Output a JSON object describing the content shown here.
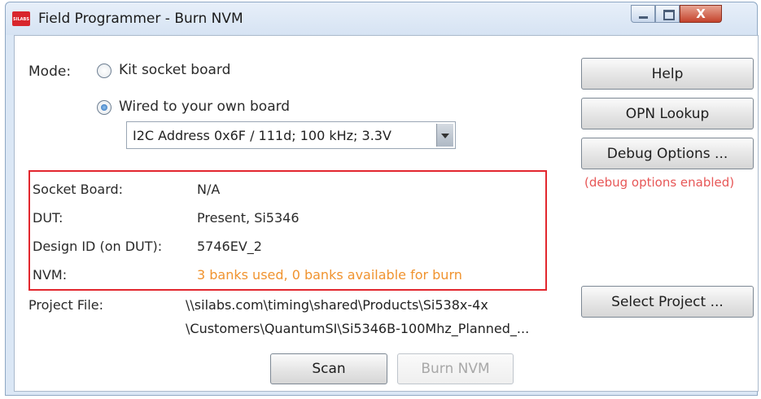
{
  "window": {
    "title": "Field Programmer - Burn NVM",
    "icon_text": "SILABS",
    "close_glyph": "X"
  },
  "mode": {
    "label": "Mode:",
    "options": [
      {
        "label": "Kit socket board",
        "selected": false
      },
      {
        "label": "Wired to your own board",
        "selected": true
      }
    ],
    "interface_select": {
      "value": "I2C Address 0x6F / 111d; 100 kHz; 3.3V"
    }
  },
  "status": {
    "rows": [
      {
        "label": "Socket Board:",
        "value": "N/A"
      },
      {
        "label": "DUT:",
        "value": "Present, Si5346"
      },
      {
        "label": "Design ID (on DUT):",
        "value": "5746EV_2"
      },
      {
        "label": "NVM:",
        "value": "3 banks used, 0 banks available for burn",
        "color": "#f0932f"
      }
    ],
    "highlight_color": "#e2272e"
  },
  "project": {
    "label": "Project File:",
    "path_line1": "\\\\silabs.com\\timing\\shared\\Products\\Si538x-4x",
    "path_line2": "\\Customers\\QuantumSI\\Si5346B-100Mhz_Planned_..."
  },
  "buttons": {
    "help": "Help",
    "opn_lookup": "OPN Lookup",
    "debug_options": "Debug Options ...",
    "select_project": "Select Project ...",
    "scan": "Scan",
    "burn_nvm": "Burn NVM",
    "burn_nvm_enabled": false
  },
  "debug_note": "(debug options enabled)"
}
